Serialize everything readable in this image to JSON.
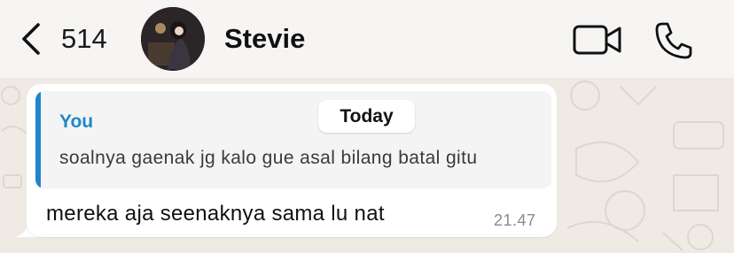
{
  "header": {
    "back_count": "514",
    "contact_name": "Stevie",
    "icons": {
      "back": "chevron-left-icon",
      "avatar": "avatar",
      "video": "video-camera-icon",
      "call": "phone-icon"
    }
  },
  "chat": {
    "date_label": "Today",
    "message": {
      "reply": {
        "author": "You",
        "text": "soalnya gaenak jg kalo gue asal bilang batal gitu"
      },
      "text": "mereka aja seenaknya sama lu nat",
      "time": "21.47"
    }
  },
  "colors": {
    "accent_blue": "#1f86c9",
    "chat_background": "#efebe4",
    "bubble": "#ffffff"
  }
}
